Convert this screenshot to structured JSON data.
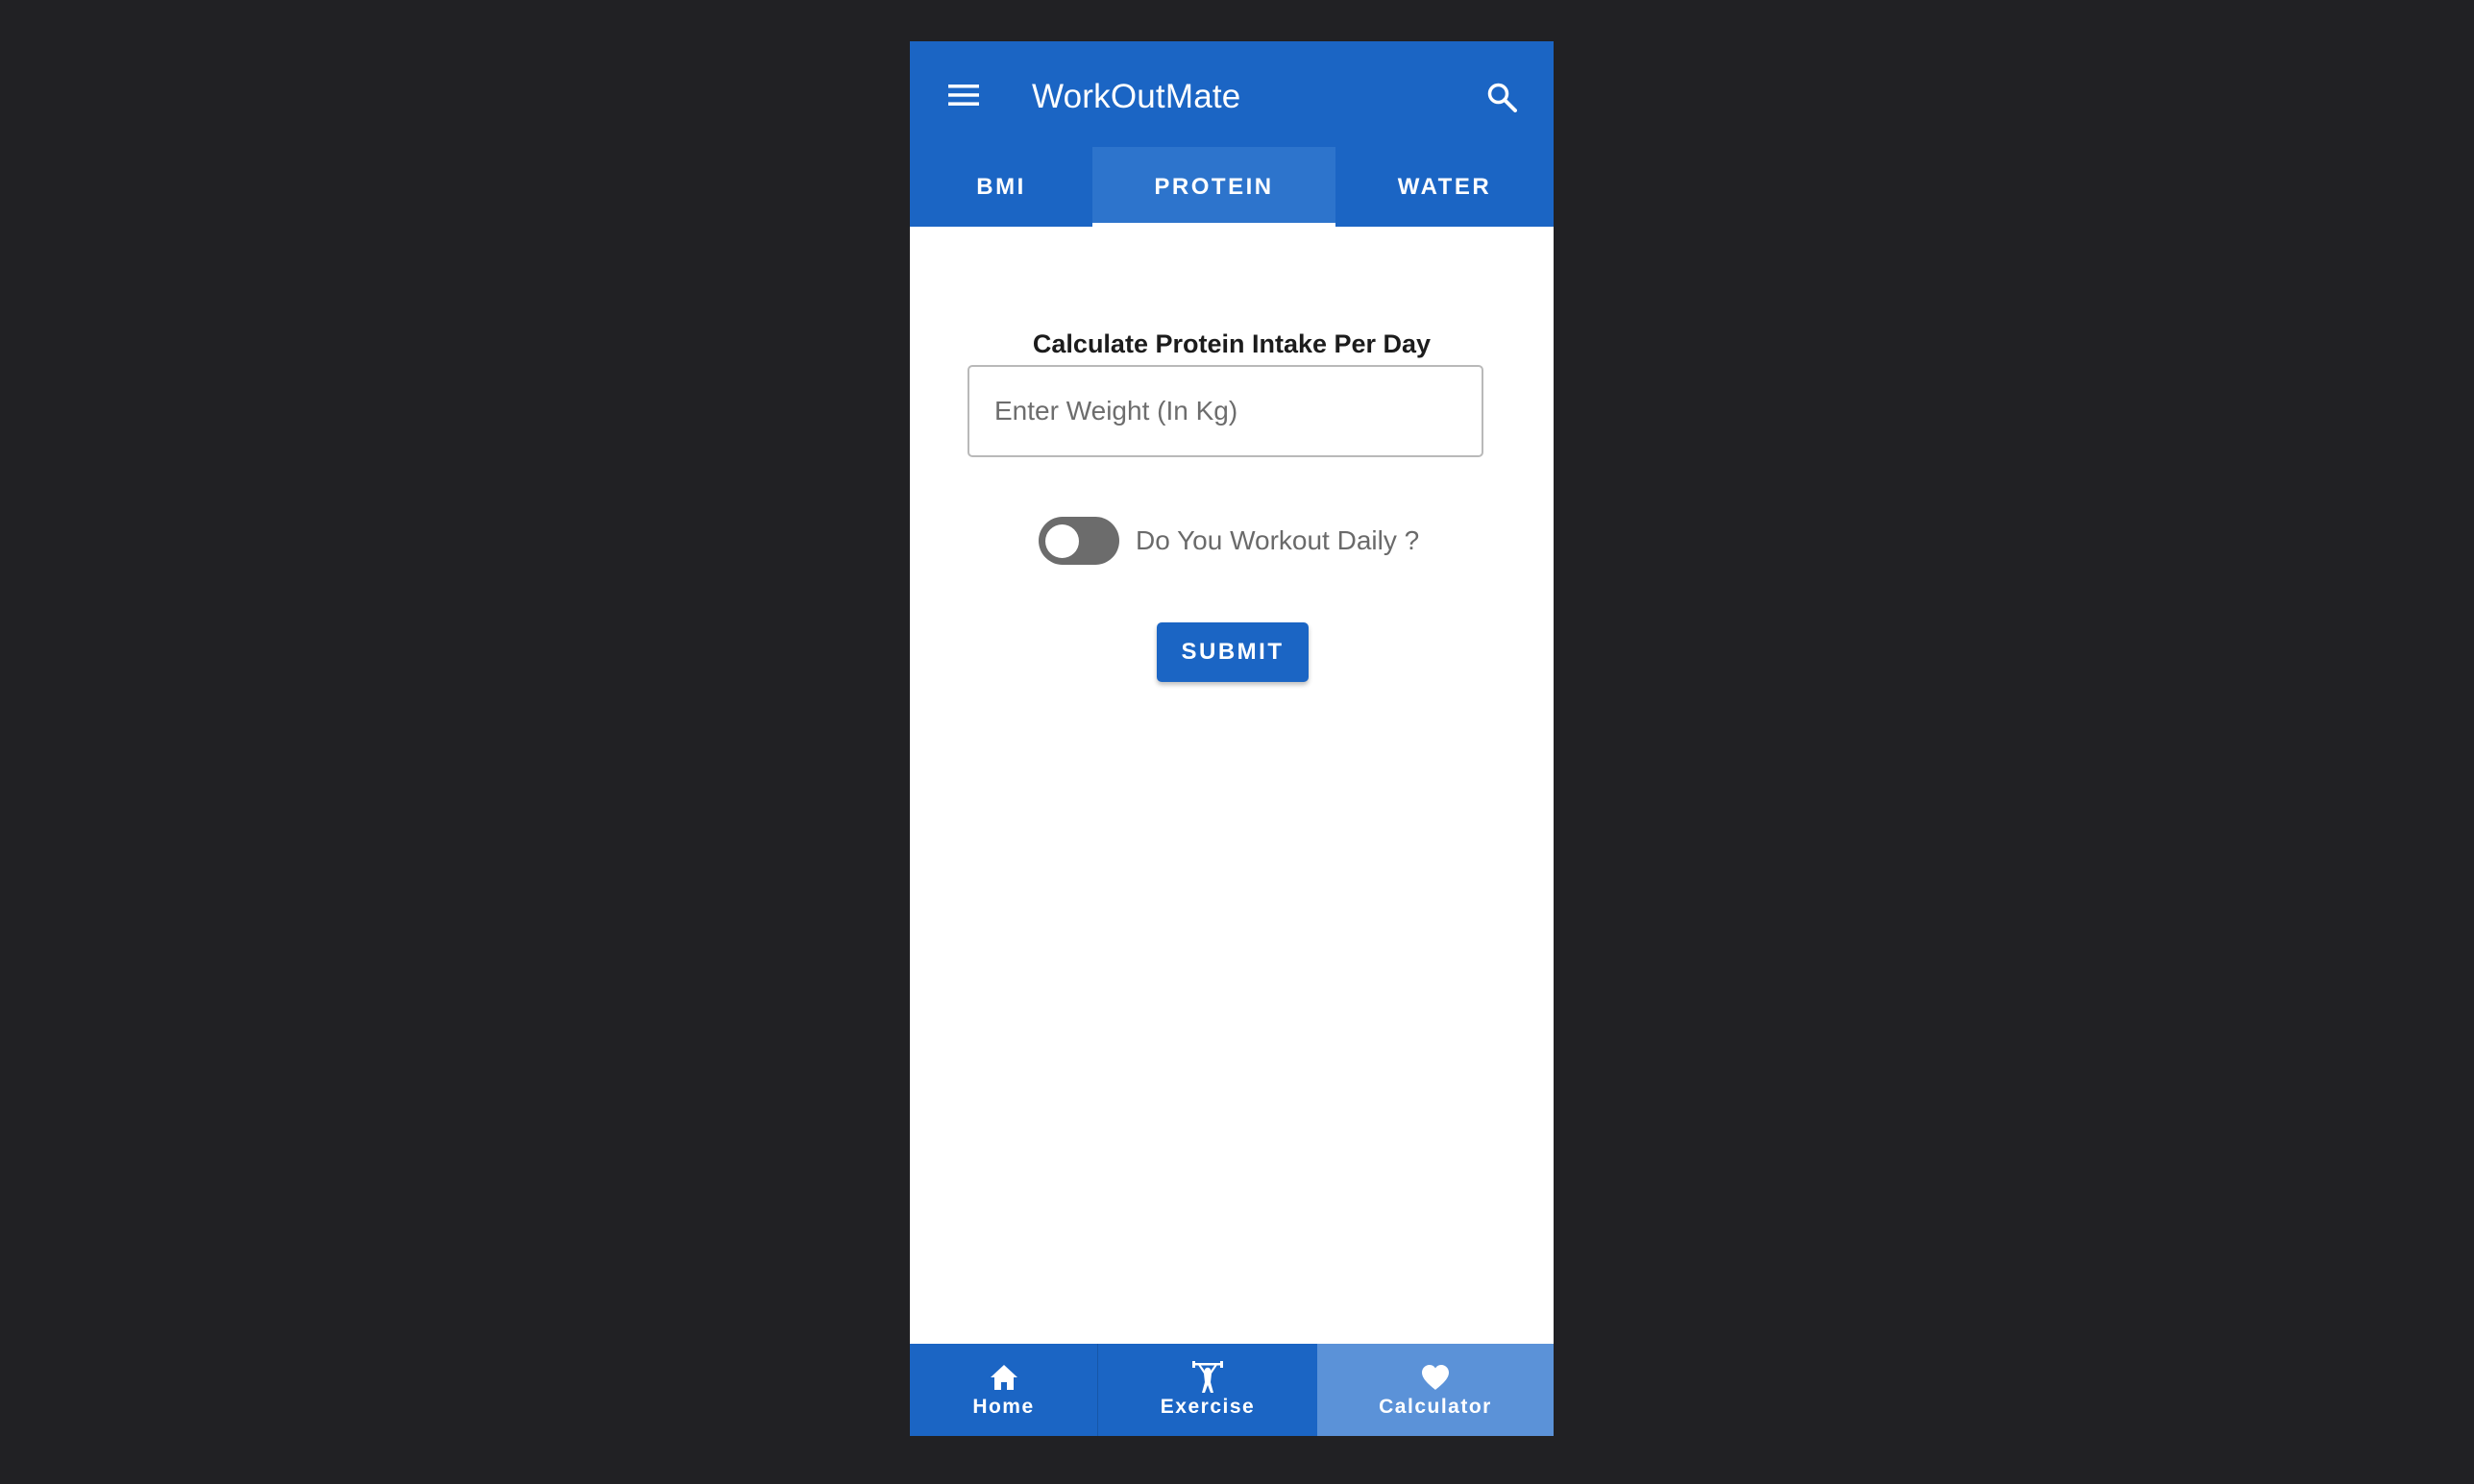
{
  "app": {
    "title": "WorkOutMate",
    "accent_color": "#1b65c4",
    "background_color": "#212124"
  },
  "header": {
    "menu_icon": "menu-icon",
    "search_icon": "search-icon"
  },
  "tabs": [
    {
      "label": "BMI",
      "selected": false
    },
    {
      "label": "PROTEIN",
      "selected": true
    },
    {
      "label": "WATER",
      "selected": false
    }
  ],
  "protein_form": {
    "title": "Calculate Protein Intake Per Day",
    "weight_placeholder": "Enter Weight (In Kg)",
    "weight_value": "",
    "workout_toggle_label": "Do You Workout Daily ?",
    "workout_toggle_on": false,
    "submit_label": "SUBMIT"
  },
  "bottom_nav": [
    {
      "label": "Home",
      "icon": "home-icon",
      "selected": false
    },
    {
      "label": "Exercise",
      "icon": "weightlifter-icon",
      "selected": false
    },
    {
      "label": "Calculator",
      "icon": "heart-icon",
      "selected": true
    }
  ]
}
